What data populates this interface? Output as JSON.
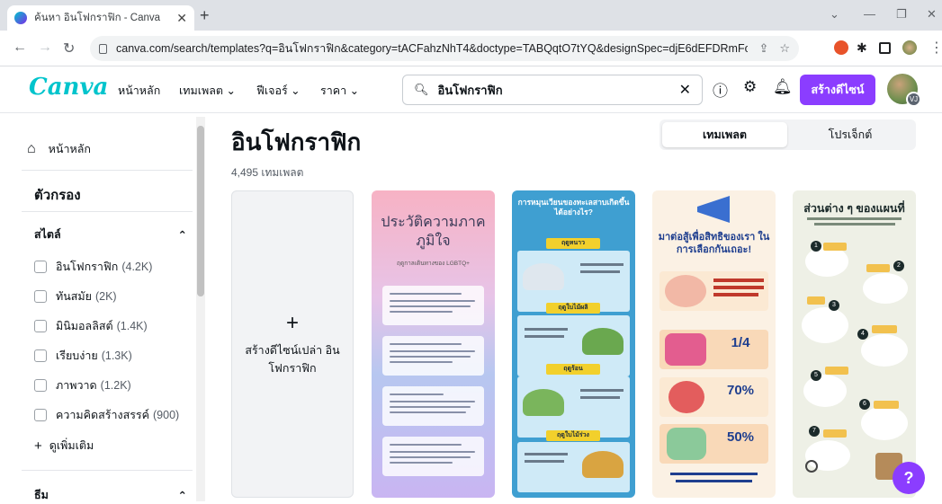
{
  "browser": {
    "tab_title": "ค้นหา อินโฟกราฟิก - Canva",
    "url": "canva.com/search/templates?q=อินโฟกราฟิก&category=tACFahzNhT4&doctype=TABQqtO7tYQ&designSpec=djE6dEFDRmFoek5oVDQ6Z2xvYm..."
  },
  "header": {
    "logo": "Canva",
    "nav": [
      "หน้าหลัก",
      "เทมเพลต",
      "ฟีเจอร์",
      "ราคา"
    ],
    "search_value": "อินโฟกราฟิก",
    "create_label": "สร้างดีไซน์",
    "avatar_initials": "VJ",
    "accent": "#8b3dff"
  },
  "sidebar": {
    "home": "หน้าหลัก",
    "filters_title": "ตัวกรอง",
    "style_title": "สไตล์",
    "style_options": [
      {
        "label": "อินโฟกราฟิก",
        "count": "(4.2K)"
      },
      {
        "label": "ทันสมัย",
        "count": "(2K)"
      },
      {
        "label": "มินิมอลลิสต์",
        "count": "(1.4K)"
      },
      {
        "label": "เรียบง่าย",
        "count": "(1.3K)"
      },
      {
        "label": "ภาพวาด",
        "count": "(1.2K)"
      },
      {
        "label": "ความคิดสร้างสรรค์",
        "count": "(900)"
      }
    ],
    "see_more": "ดูเพิ่มเติม",
    "theme_title": "ธีม"
  },
  "main": {
    "title": "อินโฟกราฟิก",
    "count": "4,495 เทมเพลต",
    "tabs": [
      "เทมเพลต",
      "โปรเจ็กต์"
    ],
    "blank_card": "สร้างดีไซน์เปล่า อินโฟกราฟิก",
    "cards": [
      {
        "title": "ประวัติความภาคภูมิใจ",
        "subtitle": "ฤดูกาลเดินทางของ LGBTQ+"
      },
      {
        "title": "การหมุนเวียนของทะเลสาบเกิดขึ้นได้อย่างไร?",
        "tags": [
          "ฤดูหนาว",
          "ฤดูใบไม้ผลิ",
          "ฤดูร้อน",
          "ฤดูใบไม้ร่วง"
        ]
      },
      {
        "title": "มาต่อสู้เพื่อสิทธิของเรา ในการเลือกกันเถอะ!",
        "stats": [
          "1/4",
          "70%",
          "50%"
        ]
      },
      {
        "title": "ส่วนต่าง ๆ ของแผนที่",
        "numbers": [
          "1",
          "2",
          "3",
          "4",
          "5",
          "6",
          "7"
        ]
      }
    ]
  },
  "help_label": "?"
}
